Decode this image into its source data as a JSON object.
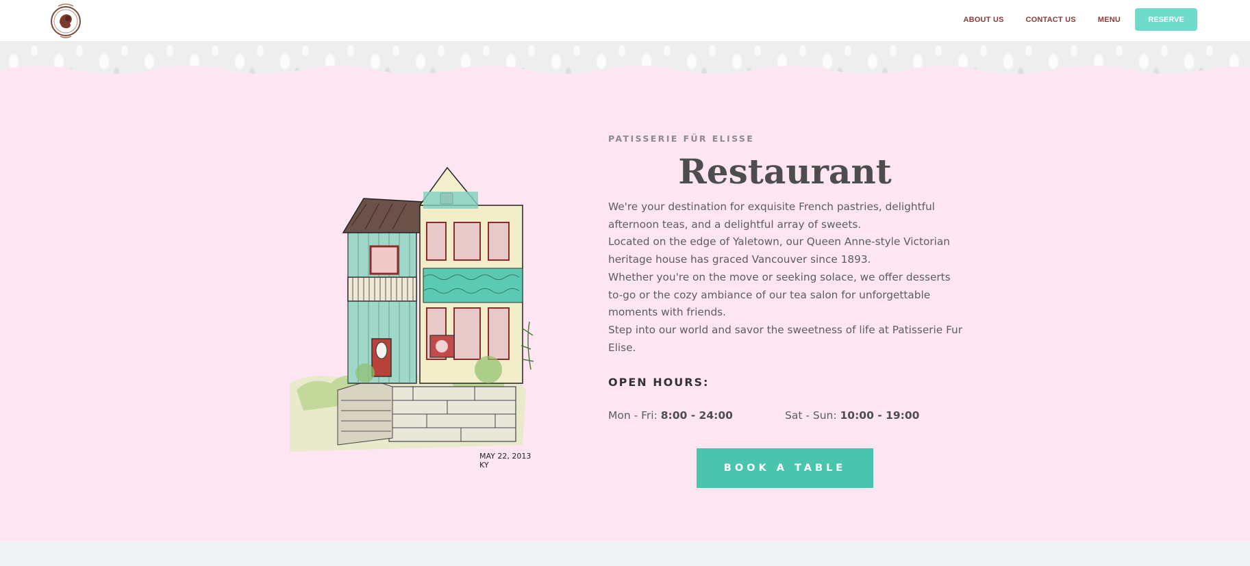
{
  "header": {
    "nav": {
      "about_label": "ABOUT US",
      "contact_label": "CONTACT US",
      "menu_label": "MENU",
      "reserve_label": "RESERVE"
    }
  },
  "hero": {
    "eyebrow": "PATISSERIE FÜR ELISSE",
    "title": "Restaurant",
    "paragraphs": [
      "We're your destination for exquisite French pastries, delightful afternoon teas, and a delightful array of sweets.",
      "Located on the edge of Yaletown, our Queen Anne-style Victorian heritage house has graced Vancouver since 1893.",
      "Whether you're on the move or seeking solace, we offer desserts to-go or the cozy ambiance of our tea salon for unforgettable moments with friends.",
      "Step into our world and savor the sweetness of life at Patisserie Fur Elise."
    ],
    "hours_title": "OPEN HOURS:",
    "weekday_label": "Mon - Fri:",
    "weekday_time": "8:00 - 24:00",
    "weekend_label": "Sat - Sun:",
    "weekend_time": "10:00 - 19:00",
    "book_label": "BOOK A TABLE",
    "sketch_caption": "MAY 22, 2013 KY"
  },
  "colors": {
    "hero_bg": "#fde5f2",
    "accent_teal": "#4bc4ae",
    "reserve_teal": "#6fdccb",
    "nav_text": "#8b3a3a"
  }
}
